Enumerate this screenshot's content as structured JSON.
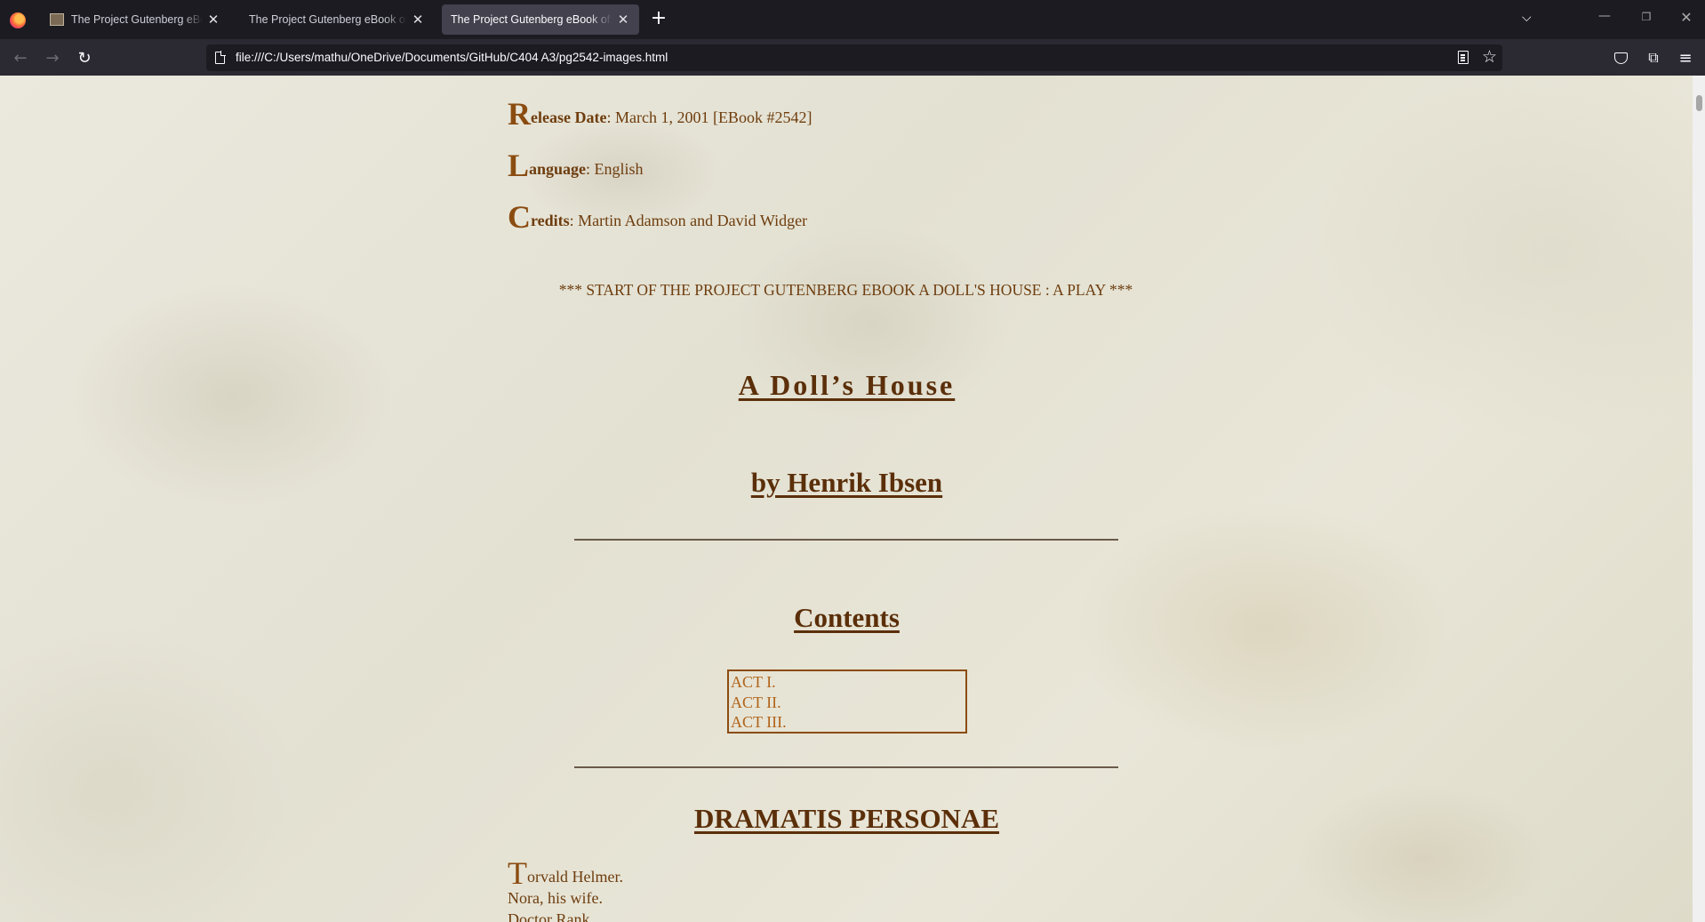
{
  "browser": {
    "tabs": [
      {
        "title": "The Project Gutenberg eBook of",
        "active": false
      },
      {
        "title": "The Project Gutenberg eBook of The",
        "active": false
      },
      {
        "title": "The Project Gutenberg eBook of A D",
        "active": true
      }
    ],
    "new_tab_symbol": "+",
    "tab_list_symbol": "⌵",
    "window_controls": {
      "minimize": "—",
      "restore": "❐",
      "close": "✕"
    },
    "nav": {
      "back": "←",
      "forward": "→",
      "reload": "↻"
    },
    "url": "file:///C:/Users/mathu/OneDrive/Documents/GitHub/C404 A3/pg2542-images.html",
    "star_symbol": "☆",
    "menu_symbol": "≡",
    "extensions_symbol": "⧉",
    "icons": [
      "firefox-icon",
      "page-icon",
      "reader-view-icon",
      "bookmark-star-icon",
      "pocket-icon",
      "extensions-icon",
      "menu-icon"
    ]
  },
  "page": {
    "release": {
      "cap": "R",
      "label": "elease Date",
      "value": ": March 1, 2001 [EBook #2542]"
    },
    "language": {
      "cap": "L",
      "label": "anguage",
      "value": ": English"
    },
    "credits": {
      "cap": "C",
      "label": "redits",
      "value": ": Martin Adamson and David Widger"
    },
    "start_banner": "*** START OF THE PROJECT GUTENBERG EBOOK A DOLL'S HOUSE : A PLAY ***",
    "title": "A  Doll’s  House",
    "author": "by Henrik Ibsen",
    "contents_heading": "Contents",
    "contents": [
      "ACT I.",
      "ACT II.",
      "ACT III."
    ],
    "personae_heading": "DRAMATIS PERSONAE",
    "cast": {
      "first_cap": "T",
      "first_rest": "orvald Helmer.",
      "lines": [
        "Nora, his wife.",
        "Doctor Rank."
      ]
    }
  },
  "colors": {
    "text_brown": "#6e3d0e",
    "heading_brown": "#5b2f0a",
    "link_orange": "#b0641a",
    "paper": "#e8e6d9",
    "chrome_dark": "#1c1b22",
    "chrome_bar": "#2b2a33"
  }
}
